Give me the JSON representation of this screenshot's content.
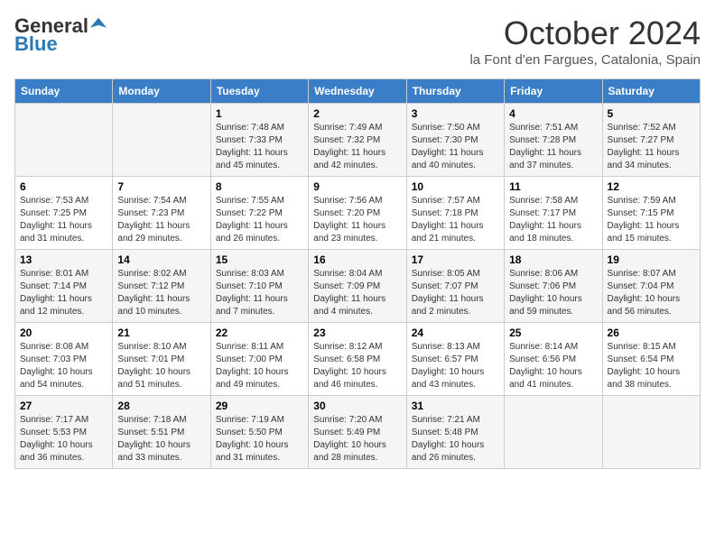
{
  "logo": {
    "line1": "General",
    "line2": "Blue"
  },
  "title": "October 2024",
  "location": "la Font d'en Fargues, Catalonia, Spain",
  "days_of_week": [
    "Sunday",
    "Monday",
    "Tuesday",
    "Wednesday",
    "Thursday",
    "Friday",
    "Saturday"
  ],
  "weeks": [
    [
      {
        "day": "",
        "sunrise": "",
        "sunset": "",
        "daylight": ""
      },
      {
        "day": "",
        "sunrise": "",
        "sunset": "",
        "daylight": ""
      },
      {
        "day": "1",
        "sunrise": "Sunrise: 7:48 AM",
        "sunset": "Sunset: 7:33 PM",
        "daylight": "Daylight: 11 hours and 45 minutes."
      },
      {
        "day": "2",
        "sunrise": "Sunrise: 7:49 AM",
        "sunset": "Sunset: 7:32 PM",
        "daylight": "Daylight: 11 hours and 42 minutes."
      },
      {
        "day": "3",
        "sunrise": "Sunrise: 7:50 AM",
        "sunset": "Sunset: 7:30 PM",
        "daylight": "Daylight: 11 hours and 40 minutes."
      },
      {
        "day": "4",
        "sunrise": "Sunrise: 7:51 AM",
        "sunset": "Sunset: 7:28 PM",
        "daylight": "Daylight: 11 hours and 37 minutes."
      },
      {
        "day": "5",
        "sunrise": "Sunrise: 7:52 AM",
        "sunset": "Sunset: 7:27 PM",
        "daylight": "Daylight: 11 hours and 34 minutes."
      }
    ],
    [
      {
        "day": "6",
        "sunrise": "Sunrise: 7:53 AM",
        "sunset": "Sunset: 7:25 PM",
        "daylight": "Daylight: 11 hours and 31 minutes."
      },
      {
        "day": "7",
        "sunrise": "Sunrise: 7:54 AM",
        "sunset": "Sunset: 7:23 PM",
        "daylight": "Daylight: 11 hours and 29 minutes."
      },
      {
        "day": "8",
        "sunrise": "Sunrise: 7:55 AM",
        "sunset": "Sunset: 7:22 PM",
        "daylight": "Daylight: 11 hours and 26 minutes."
      },
      {
        "day": "9",
        "sunrise": "Sunrise: 7:56 AM",
        "sunset": "Sunset: 7:20 PM",
        "daylight": "Daylight: 11 hours and 23 minutes."
      },
      {
        "day": "10",
        "sunrise": "Sunrise: 7:57 AM",
        "sunset": "Sunset: 7:18 PM",
        "daylight": "Daylight: 11 hours and 21 minutes."
      },
      {
        "day": "11",
        "sunrise": "Sunrise: 7:58 AM",
        "sunset": "Sunset: 7:17 PM",
        "daylight": "Daylight: 11 hours and 18 minutes."
      },
      {
        "day": "12",
        "sunrise": "Sunrise: 7:59 AM",
        "sunset": "Sunset: 7:15 PM",
        "daylight": "Daylight: 11 hours and 15 minutes."
      }
    ],
    [
      {
        "day": "13",
        "sunrise": "Sunrise: 8:01 AM",
        "sunset": "Sunset: 7:14 PM",
        "daylight": "Daylight: 11 hours and 12 minutes."
      },
      {
        "day": "14",
        "sunrise": "Sunrise: 8:02 AM",
        "sunset": "Sunset: 7:12 PM",
        "daylight": "Daylight: 11 hours and 10 minutes."
      },
      {
        "day": "15",
        "sunrise": "Sunrise: 8:03 AM",
        "sunset": "Sunset: 7:10 PM",
        "daylight": "Daylight: 11 hours and 7 minutes."
      },
      {
        "day": "16",
        "sunrise": "Sunrise: 8:04 AM",
        "sunset": "Sunset: 7:09 PM",
        "daylight": "Daylight: 11 hours and 4 minutes."
      },
      {
        "day": "17",
        "sunrise": "Sunrise: 8:05 AM",
        "sunset": "Sunset: 7:07 PM",
        "daylight": "Daylight: 11 hours and 2 minutes."
      },
      {
        "day": "18",
        "sunrise": "Sunrise: 8:06 AM",
        "sunset": "Sunset: 7:06 PM",
        "daylight": "Daylight: 10 hours and 59 minutes."
      },
      {
        "day": "19",
        "sunrise": "Sunrise: 8:07 AM",
        "sunset": "Sunset: 7:04 PM",
        "daylight": "Daylight: 10 hours and 56 minutes."
      }
    ],
    [
      {
        "day": "20",
        "sunrise": "Sunrise: 8:08 AM",
        "sunset": "Sunset: 7:03 PM",
        "daylight": "Daylight: 10 hours and 54 minutes."
      },
      {
        "day": "21",
        "sunrise": "Sunrise: 8:10 AM",
        "sunset": "Sunset: 7:01 PM",
        "daylight": "Daylight: 10 hours and 51 minutes."
      },
      {
        "day": "22",
        "sunrise": "Sunrise: 8:11 AM",
        "sunset": "Sunset: 7:00 PM",
        "daylight": "Daylight: 10 hours and 49 minutes."
      },
      {
        "day": "23",
        "sunrise": "Sunrise: 8:12 AM",
        "sunset": "Sunset: 6:58 PM",
        "daylight": "Daylight: 10 hours and 46 minutes."
      },
      {
        "day": "24",
        "sunrise": "Sunrise: 8:13 AM",
        "sunset": "Sunset: 6:57 PM",
        "daylight": "Daylight: 10 hours and 43 minutes."
      },
      {
        "day": "25",
        "sunrise": "Sunrise: 8:14 AM",
        "sunset": "Sunset: 6:56 PM",
        "daylight": "Daylight: 10 hours and 41 minutes."
      },
      {
        "day": "26",
        "sunrise": "Sunrise: 8:15 AM",
        "sunset": "Sunset: 6:54 PM",
        "daylight": "Daylight: 10 hours and 38 minutes."
      }
    ],
    [
      {
        "day": "27",
        "sunrise": "Sunrise: 7:17 AM",
        "sunset": "Sunset: 5:53 PM",
        "daylight": "Daylight: 10 hours and 36 minutes."
      },
      {
        "day": "28",
        "sunrise": "Sunrise: 7:18 AM",
        "sunset": "Sunset: 5:51 PM",
        "daylight": "Daylight: 10 hours and 33 minutes."
      },
      {
        "day": "29",
        "sunrise": "Sunrise: 7:19 AM",
        "sunset": "Sunset: 5:50 PM",
        "daylight": "Daylight: 10 hours and 31 minutes."
      },
      {
        "day": "30",
        "sunrise": "Sunrise: 7:20 AM",
        "sunset": "Sunset: 5:49 PM",
        "daylight": "Daylight: 10 hours and 28 minutes."
      },
      {
        "day": "31",
        "sunrise": "Sunrise: 7:21 AM",
        "sunset": "Sunset: 5:48 PM",
        "daylight": "Daylight: 10 hours and 26 minutes."
      },
      {
        "day": "",
        "sunrise": "",
        "sunset": "",
        "daylight": ""
      },
      {
        "day": "",
        "sunrise": "",
        "sunset": "",
        "daylight": ""
      }
    ]
  ]
}
